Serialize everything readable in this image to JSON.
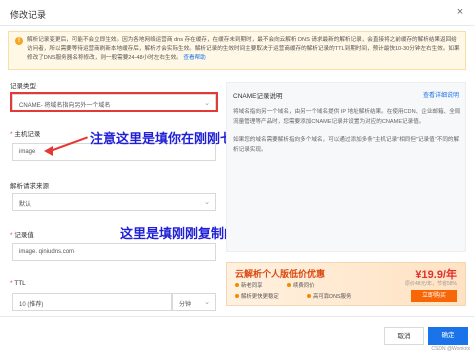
{
  "dialog": {
    "title": "修改记录",
    "close_glyph": "×"
  },
  "notice": {
    "icon_glyph": "!",
    "text": "解析记录变更后，可能不会立即生效。因为各地网络运营商 dns 存在缓存，在缓存未到期时，最不会向云解析 DNS 请求最新的解析记录，会直接将之前缓存的解析结果返回给访问者，所以需要等待运营商刷新本地缓存后，解析才会实际生效。解析记录的生效时间主要取决于运营商缓存的解析记录的TTL到期时间，预计最快10-30分钟左右生效。如果修改了DNS服务器名称修改，则一般需要24-48小时左右生效。",
    "link": "查看帮助"
  },
  "form": {
    "record_type_label": "记录类型",
    "record_type_value": "CNAME- 将域名指向另外一个域名",
    "host_label": "主机记录",
    "host_value": "image",
    "source_label": "解析请求来源",
    "source_value": "默认",
    "value_label": "记录值",
    "value_value": "image.          qiniudns.com",
    "ttl_label": "TTL",
    "ttl_value": "10 (推荐)",
    "ttl_unit": "分钟",
    "required_mark": "*",
    "caret": "⌄"
  },
  "annotations": {
    "host_note": "注意这里是填你在刚刚七牛云绑定的那个二级域名",
    "cname_note": "这里是填刚刚复制的CNAME值"
  },
  "info": {
    "title": "CNAME记录说明",
    "link": "查看详细说明",
    "body1": "将域名指向另一个域名，由另一个域名提供 IP 地址解析结果。在使用CDN、企业邮箱、全局流量管理等产品时，您需要添加CNAME记录并设置为对应的CNAME记录值。",
    "body2": "如果您的域名需要解析指向多个域名，可以通过添加多条\"主机记录\"相同但\"记录值\"不同的解析记录实现。"
  },
  "ad": {
    "title": "云解析个人版低价优惠",
    "price": "¥19.9/年",
    "orig": "原价48元/年，节省58%",
    "feat1": "新老同享",
    "feat2": "续费同价",
    "feat3": "解析更快更稳定",
    "feat4": "高可靠DNS服务",
    "button": "立即购买"
  },
  "footer": {
    "cancel": "取消",
    "ok": "确定",
    "watermark": "CSDN @Wonkrix"
  }
}
